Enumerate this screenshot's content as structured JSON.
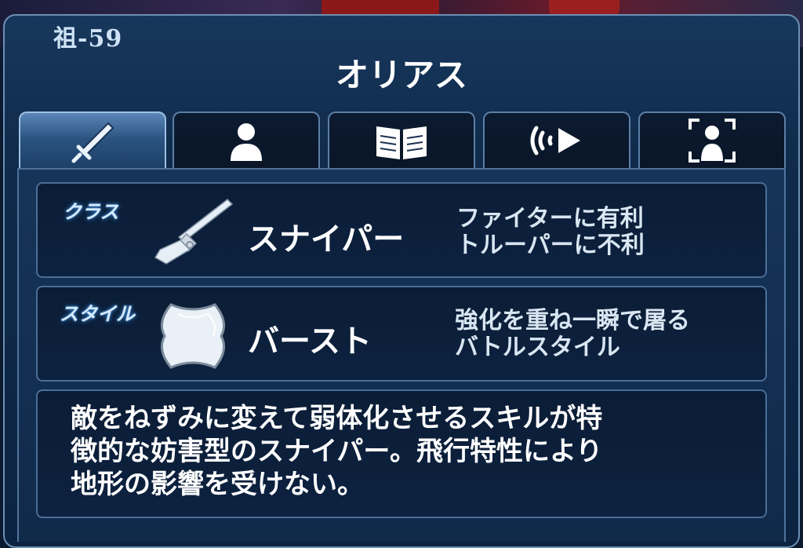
{
  "header": {
    "code": "祖-59",
    "title": "オリアス"
  },
  "tabs": [
    {
      "icon": "sword-icon",
      "active": true
    },
    {
      "icon": "person-icon",
      "active": false
    },
    {
      "icon": "book-icon",
      "active": false
    },
    {
      "icon": "voice-play-icon",
      "active": false
    },
    {
      "icon": "focus-person-icon",
      "active": false
    }
  ],
  "class_row": {
    "label": "クラス",
    "icon": "rifle-icon",
    "name": "スナイパー",
    "note_line1": "ファイターに有利",
    "note_line2": "トルーパーに不利"
  },
  "style_row": {
    "label": "スタイル",
    "icon": "burst-shield-icon",
    "name": "バースト",
    "note_line1": "強化を重ね一瞬で屠る",
    "note_line2": "バトルスタイル"
  },
  "description": {
    "line1": "敵をねずみに変えて弱体化させるスキルが特",
    "line2": "徴的な妨害型のスナイパー。飛行特性により",
    "line3": "地形の影響を受けない。"
  },
  "colors": {
    "panel": "#0f2a4a",
    "border": "#6d8fb3",
    "label_glow": "#3a8ad8",
    "text": "#ffffff"
  }
}
